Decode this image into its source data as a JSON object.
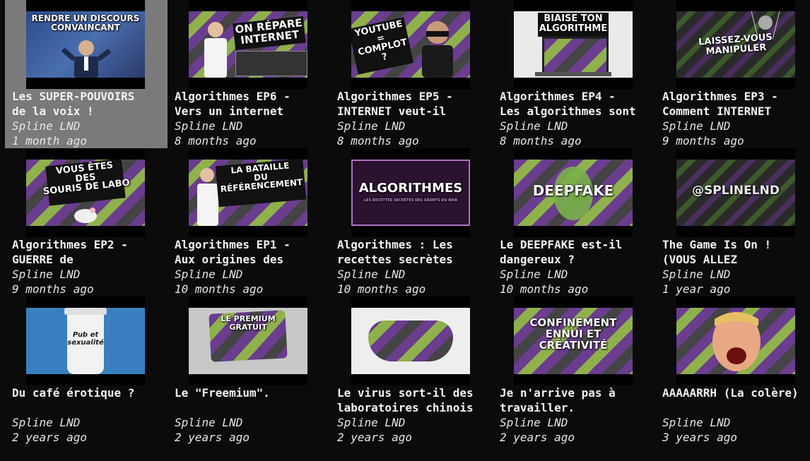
{
  "videos": [
    {
      "title": "Les SUPER-POUVOIRS\nde la voix !",
      "author": "Spline LND",
      "age": "1 month ago",
      "thumb_text": "RENDRE UN DISCOURS\nCONVAINCANT",
      "thumb_icon": "speaker-person-icon"
    },
    {
      "title": "Algorithmes EP6 -\nVers un internet",
      "author": "Spline LND",
      "age": "8 months ago",
      "thumb_text": "ON RÉPARE\nINTERNET",
      "thumb_icon": "repair-person-icon"
    },
    {
      "title": "Algorithmes EP5 -\nINTERNET veut-il",
      "author": "Spline LND",
      "age": "8 months ago",
      "thumb_text": "YOUTUBE\n=\nCOMPLOT ?",
      "thumb_icon": "masked-person-icon"
    },
    {
      "title": "Algorithmes EP4 -\nLes algorithmes sont",
      "author": "Spline LND",
      "age": "8 months ago",
      "thumb_text": "BIAISE TON\nALGORITHME",
      "thumb_icon": "laptop-icon"
    },
    {
      "title": "Algorithmes EP3 -\nComment INTERNET",
      "author": "Spline LND",
      "age": "9 months ago",
      "thumb_text": "LAISSEZ-VOUS\nMANIPULER",
      "thumb_icon": "puppet-icon"
    },
    {
      "title": "Algorithmes EP2 -\nGUERRE de",
      "author": "Spline LND",
      "age": "9 months ago",
      "thumb_text": "VOUS ÊTES\nDES\nSOURIS DE LABO",
      "thumb_icon": "lab-mouse-icon"
    },
    {
      "title": "Algorithmes EP1 -\nAux origines des",
      "author": "Spline LND",
      "age": "10 months ago",
      "thumb_text": "LA BATAILLE\nDU\nRÉFÉRENCEMENT",
      "thumb_icon": "phone-person-icon"
    },
    {
      "title": "Algorithmes : Les\nrecettes secrètes",
      "author": "Spline LND",
      "age": "10 months ago",
      "thumb_text": "ALGORITHMES",
      "thumb_subtext": "LES RECETTES SECRÈTES DES GÉANTS DU WEB",
      "thumb_icon": "title-card-icon"
    },
    {
      "title": "Le DEEPFAKE est-il\ndangereux ?",
      "author": "Spline LND",
      "age": "10 months ago",
      "thumb_text": "DEEPFAKE",
      "thumb_icon": "face-icon"
    },
    {
      "title": "The Game Is On !\n(VOUS ALLEZ",
      "author": "Spline LND",
      "age": "1 year ago",
      "thumb_text": "@SPLINELND",
      "thumb_icon": "logo-icon"
    },
    {
      "title": "Du café érotique ?",
      "author": "Spline LND",
      "age": "2 years ago",
      "thumb_text": "Pub et\nsexualité",
      "thumb_icon": "coffee-cup-icon"
    },
    {
      "title": "Le \"Freemium\".",
      "author": "Spline LND",
      "age": "2 years ago",
      "thumb_text": "LE PREMIUM\nGRATUIT",
      "thumb_icon": "credit-card-icon"
    },
    {
      "title": "Le virus sort-il des\nlaboratoires chinois",
      "author": "Spline LND",
      "age": "2 years ago",
      "thumb_text": "",
      "thumb_icon": "face-mask-icon"
    },
    {
      "title": "Je n'arrive pas à\ntravailler.",
      "author": "Spline LND",
      "age": "2 years ago",
      "thumb_text": "CONFINEMENT\nENNUI ET\nCRÉATIVITÉ",
      "thumb_icon": "title-card-icon"
    },
    {
      "title": "AAAAARRH (La colère)",
      "author": "Spline LND",
      "age": "3 years ago",
      "thumb_text": "",
      "thumb_icon": "angry-face-icon"
    }
  ],
  "selected_index": 0,
  "colors": {
    "background": "#0b0b0b",
    "selected": "#7a7a7a",
    "stripe_purple": "#6a3d8f",
    "stripe_green": "#8fb14a",
    "text": "#f2f2f2"
  }
}
